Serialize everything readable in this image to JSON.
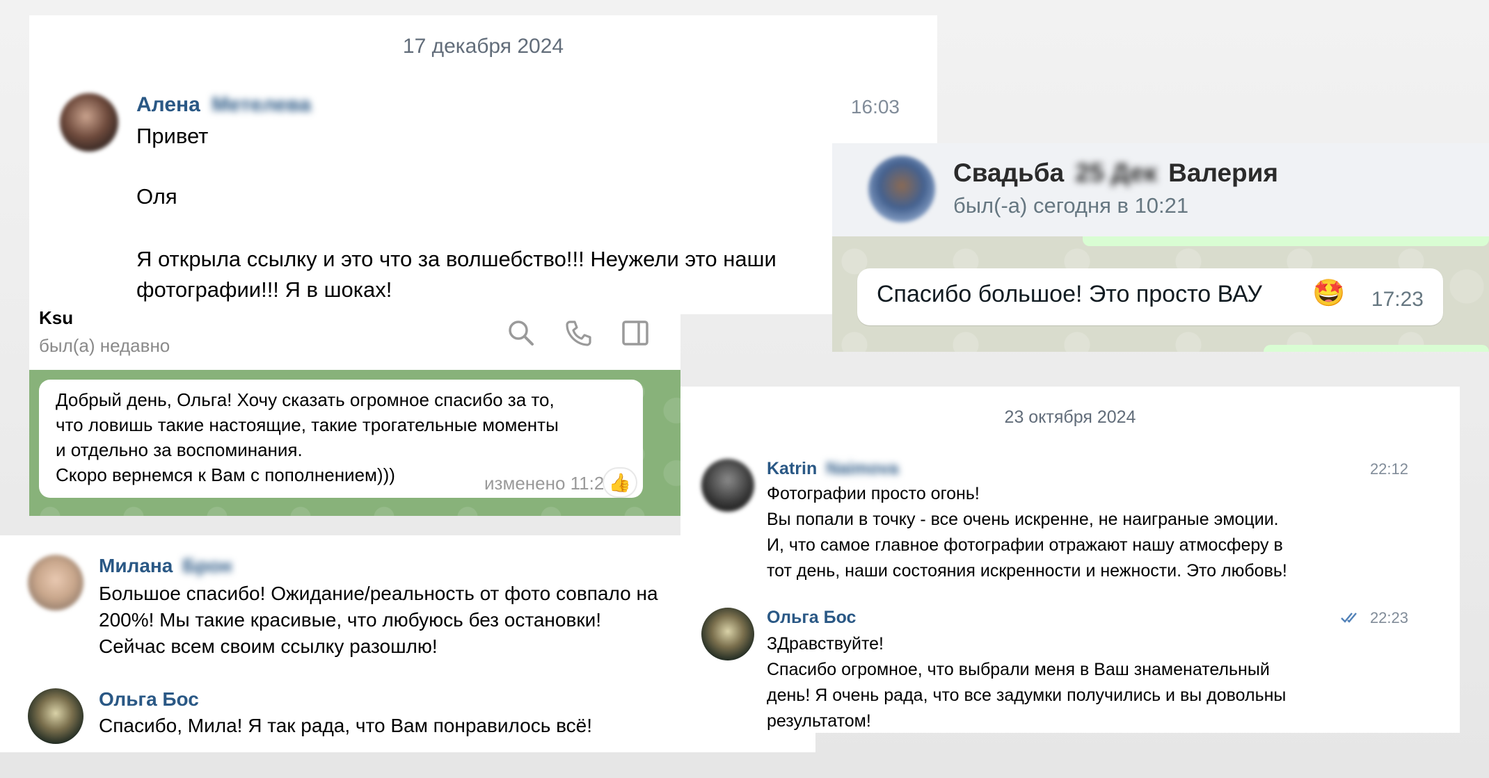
{
  "card_alena": {
    "date": "17 декабря 2024",
    "name": "Алена",
    "surname_blurred": "Метелева",
    "time": "16:03",
    "lines": [
      "Привет",
      "Оля",
      "Я открыла ссылку и это что за волшебство!!! Неужели это наши",
      "фотографии!!! Я в шоках!"
    ]
  },
  "card_ksu": {
    "name": "Ksu",
    "status": "был(а) недавно",
    "message_lines": [
      "Добрый день, Ольга! Хочу сказать огромное спасибо за то,",
      "что ловишь такие настоящие, такие трогательные моменты",
      "и отдельно за воспоминания.",
      "Скоро вернемся к Вам с пополнением)))"
    ],
    "edited": "изменено 11:25",
    "reaction": "👍",
    "icons": [
      "search-icon",
      "phone-icon",
      "sidebar-panel-icon"
    ]
  },
  "card_wedding": {
    "title": "Свадьба",
    "title_blurred": "25 Дек",
    "title_end": "Валерия",
    "status": "был(-а) сегодня в 10:21",
    "message": "Спасибо большое! Это просто ВАУ",
    "emoji": "🤩",
    "time": "17:23"
  },
  "card_milana": {
    "messages": [
      {
        "name": "Милана",
        "surname_blurred": "Брон",
        "lines": [
          "Большое спасибо! Ожидание/реальность от фото совпало на",
          "200%! Мы такие красивые, что любуюсь без остановки!",
          "Сейчас всем своим ссылку разошлю!"
        ]
      },
      {
        "name": "Ольга Бос",
        "lines": [
          "Спасибо, Мила! Я так рада, что Вам понравилось всё!"
        ]
      }
    ]
  },
  "card_katrin": {
    "date": "23 октября 2024",
    "messages": [
      {
        "name": "Katrin",
        "surname_blurred": "Naimova",
        "time": "22:12",
        "lines": [
          "Фотографии просто огонь!",
          "Вы попали в точку - все очень искренне, не наиграные эмоции.",
          "И, что самое главное фотографии отражают нашу атмосферу в",
          "тот день, наши состояния искренности и нежности. Это любовь!"
        ]
      },
      {
        "name": "Ольга Бос",
        "time": "22:23",
        "read_icon": "double-check-icon",
        "lines": [
          "ЗДравствуйте!",
          "Спасибо огромное, что выбрали меня в Ваш знаменательный",
          "день! Я очень рада, что все задумки получились и вы довольны",
          "результатом!"
        ]
      }
    ]
  },
  "colors": {
    "vk_name": "#2a5885",
    "meta_gray": "#818c99",
    "tg_bg": "#88b27a",
    "wa_bg": "#d9dccd",
    "wa_green": "#25d366"
  }
}
